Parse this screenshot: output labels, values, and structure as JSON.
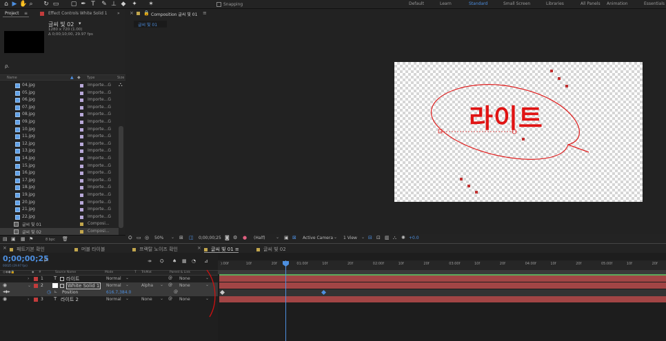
{
  "toolbar": {
    "snapping_label": "Snapping",
    "workspaces": [
      "Default",
      "Learn",
      "Standard",
      "Small Screen",
      "Libraries",
      "All Panels",
      "Animation",
      "Essentials"
    ],
    "active_workspace": "Standard"
  },
  "project": {
    "tab_project": "Project",
    "tab_effects": "Effect Controls White Solid 1",
    "selected": {
      "name": "글씨 빛 02",
      "dims": "1280 x 720 (1.00)",
      "duration": "Δ 0;00;10;00, 29.97 fps"
    },
    "search_placeholder": "ρ.",
    "col_name": "Name",
    "col_type": "Type",
    "col_size": "Size",
    "items": [
      {
        "name": "04.jpg",
        "type": "Importe...G"
      },
      {
        "name": "05.jpg",
        "type": "Importe...G"
      },
      {
        "name": "06.jpg",
        "type": "Importe...G"
      },
      {
        "name": "07.jpg",
        "type": "Importe...G"
      },
      {
        "name": "08.jpg",
        "type": "Importe...G"
      },
      {
        "name": "09.jpg",
        "type": "Importe...G"
      },
      {
        "name": "10.jpg",
        "type": "Importe...G"
      },
      {
        "name": "11.jpg",
        "type": "Importe...G"
      },
      {
        "name": "12.jpg",
        "type": "Importe...G"
      },
      {
        "name": "13.jpg",
        "type": "Importe...G"
      },
      {
        "name": "14.jpg",
        "type": "Importe...G"
      },
      {
        "name": "15.jpg",
        "type": "Importe...G"
      },
      {
        "name": "16.jpg",
        "type": "Importe...G"
      },
      {
        "name": "17.jpg",
        "type": "Importe...G"
      },
      {
        "name": "18.jpg",
        "type": "Importe...G"
      },
      {
        "name": "19.jpg",
        "type": "Importe...G"
      },
      {
        "name": "20.jpg",
        "type": "Importe...G"
      },
      {
        "name": "21.jpg",
        "type": "Importe...G"
      },
      {
        "name": "22.jpg",
        "type": "Importe...G"
      },
      {
        "name": "글씨 빛 01",
        "type": "Composi..."
      },
      {
        "name": "글씨 빛 02",
        "type": "Composi..."
      }
    ],
    "bpc": "8 bpc"
  },
  "viewer": {
    "tab_label": "Composition 글씨 빛 01",
    "sub_tab": "글씨 빛 01",
    "canvas_text": "라이트",
    "zoom": "50%",
    "timecode": "0;00;00;25",
    "resolution": "(Half)",
    "camera": "Active Camera",
    "view": "1 View",
    "exposure": "+0.0"
  },
  "timeline": {
    "tabs": [
      "패트기본 확인",
      "머블 타이블",
      "프랙탈 노이즈 확인",
      "글씨 빛 01",
      "글씨 빛 02"
    ],
    "active_tab": "글씨 빛 01",
    "timecode": "0;00;00;25",
    "fps": "00025 (29.97 fps)",
    "search_placeholder": "ρ.",
    "headers": {
      "source": "Source Name",
      "mode": "Mode",
      "t": "T",
      "trkmat": "TrkMat",
      "parent": "Parent & Link"
    },
    "layers": [
      {
        "num": "1",
        "name": "라이트",
        "mode": "Normal",
        "trkmat": "",
        "parent": "None"
      },
      {
        "num": "2",
        "name": "White Solid 1",
        "mode": "Normal",
        "trkmat": "Alpha",
        "parent": "None"
      },
      {
        "num": "",
        "name": "Position",
        "mode": "616.7,384.0",
        "trkmat": "",
        "parent": "@"
      },
      {
        "num": "3",
        "name": "라이트 2",
        "mode": "Normal",
        "trkmat": "None",
        "parent": "None"
      }
    ],
    "ruler": [
      "):00f",
      "10f",
      "20f",
      "01:00f",
      "10f",
      "20f",
      "02:00f",
      "10f",
      "20f",
      "03:00f",
      "10f",
      "20f",
      "04:00f",
      "10f",
      "20f",
      "05:00f",
      "10f",
      "20f"
    ]
  },
  "colors": {
    "accent": "#4d8fe0",
    "track": "#a24545",
    "mask": "#e02020",
    "label_red": "#c23c3c"
  }
}
